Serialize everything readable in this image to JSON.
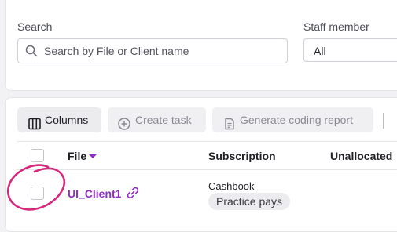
{
  "filters": {
    "search_label": "Search",
    "search_placeholder": "Search by File or Client name",
    "staff_label": "Staff member",
    "staff_value": "All"
  },
  "toolbar": {
    "columns_label": "Columns",
    "create_task_label": "Create task",
    "generate_report_label": "Generate coding report"
  },
  "table": {
    "headers": {
      "file": "File",
      "subscription": "Subscription",
      "unallocated": "Unallocated"
    },
    "rows": [
      {
        "client": "UI_Client1",
        "subscription_name": "Cashbook",
        "subscription_badge": "Practice pays"
      }
    ]
  },
  "colors": {
    "accent": "#8f2ec2",
    "annotation": "#d6287a"
  }
}
